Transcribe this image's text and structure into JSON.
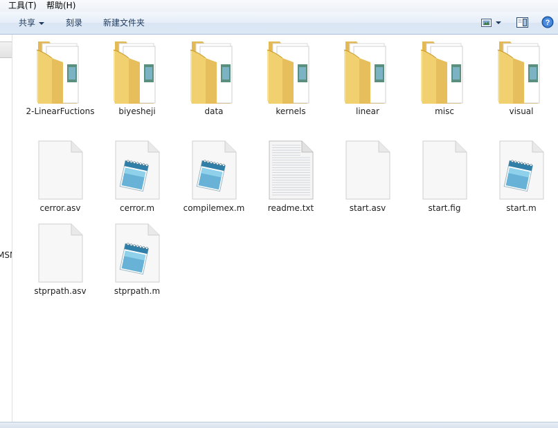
{
  "menu": {
    "items": [
      {
        "label": "工具(T)"
      },
      {
        "label": "帮助(H)"
      }
    ]
  },
  "toolbar": {
    "share_label": "共享",
    "burn_label": "刻录",
    "new_folder_label": "新建文件夹"
  },
  "nav": {
    "partial_text": "MSN"
  },
  "files": [
    {
      "name": "2-LinearFuctions",
      "type": "folder"
    },
    {
      "name": "biyesheji",
      "type": "folder"
    },
    {
      "name": "data",
      "type": "folder"
    },
    {
      "name": "kernels",
      "type": "folder"
    },
    {
      "name": "linear",
      "type": "folder"
    },
    {
      "name": "misc",
      "type": "folder"
    },
    {
      "name": "visual",
      "type": "folder"
    },
    {
      "name": "cerror.asv",
      "type": "blank"
    },
    {
      "name": "cerror.m",
      "type": "mfile"
    },
    {
      "name": "compilemex.m",
      "type": "mfile"
    },
    {
      "name": "readme.txt",
      "type": "text"
    },
    {
      "name": "start.asv",
      "type": "blank"
    },
    {
      "name": "start.fig",
      "type": "blank"
    },
    {
      "name": "start.m",
      "type": "mfile"
    },
    {
      "name": "stprpath.asv",
      "type": "blank"
    },
    {
      "name": "stprpath.m",
      "type": "mfile"
    }
  ]
}
